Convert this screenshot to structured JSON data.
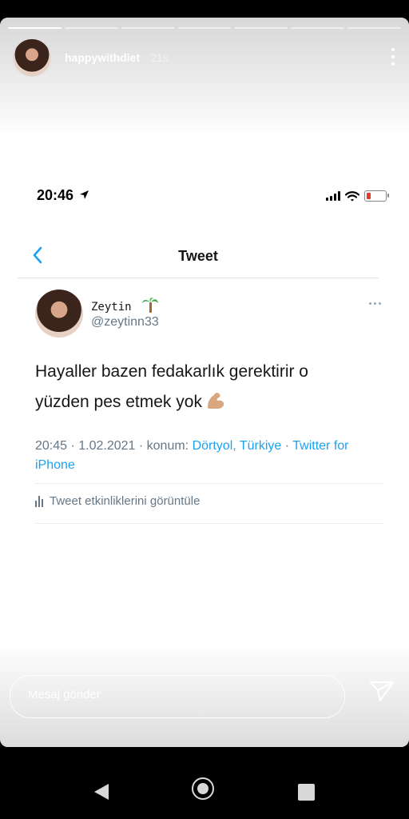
{
  "story": {
    "username": "happywithdiet",
    "time": "21s",
    "progress_total": 7,
    "progress_done": 1,
    "reply_placeholder": "Mesaj gönder"
  },
  "phone_status": {
    "time": "20:46",
    "battery_color": "#e43b2f"
  },
  "tweet_screen": {
    "title": "Tweet",
    "author_name": "Zeytin",
    "author_handle": "@zeytinn33",
    "text_line1": "Hayaller bazen fedakarlık gerektirir o",
    "text_line2": "yüzden pes etmek yok",
    "meta_prefix": "20:45 · 1.02.2021 · konum: ",
    "meta_location": "Dörtyol, Türkiye",
    "meta_sep": " · ",
    "meta_source": "Twitter for iPhone",
    "activity_label": "Tweet etkinliklerini görüntüle",
    "link_color": "#1da1f2"
  },
  "icons": [
    "more-vertical-icon",
    "location-arrow-icon",
    "signal-icon",
    "wifi-icon",
    "battery-icon",
    "back-chevron-icon",
    "palm-tree-emoji",
    "flexed-biceps-emoji",
    "more-horizontal-icon",
    "activity-chart-icon",
    "send-icon",
    "android-back-icon",
    "android-home-icon",
    "android-recents-icon"
  ]
}
